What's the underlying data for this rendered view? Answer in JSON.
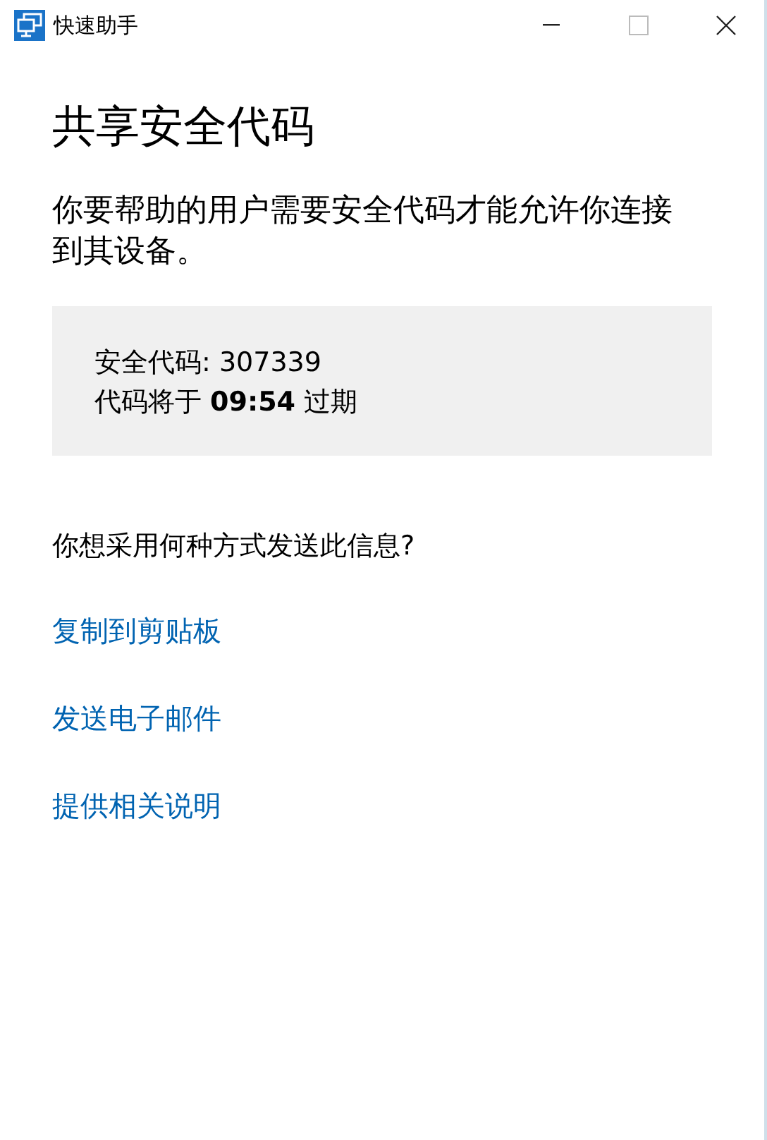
{
  "window": {
    "title": "快速助手"
  },
  "heading": "共享安全代码",
  "description": "你要帮助的用户需要安全代码才能允许你连接到其设备。",
  "code_box": {
    "code_line": "安全代码: 307339",
    "expiry_line": "代码将于 **09:54** 过期"
  },
  "question": "你想采用何种方式发送此信息?",
  "links": [
    "复制到剪贴板",
    "发送电子邮件",
    "提供相关说明"
  ]
}
